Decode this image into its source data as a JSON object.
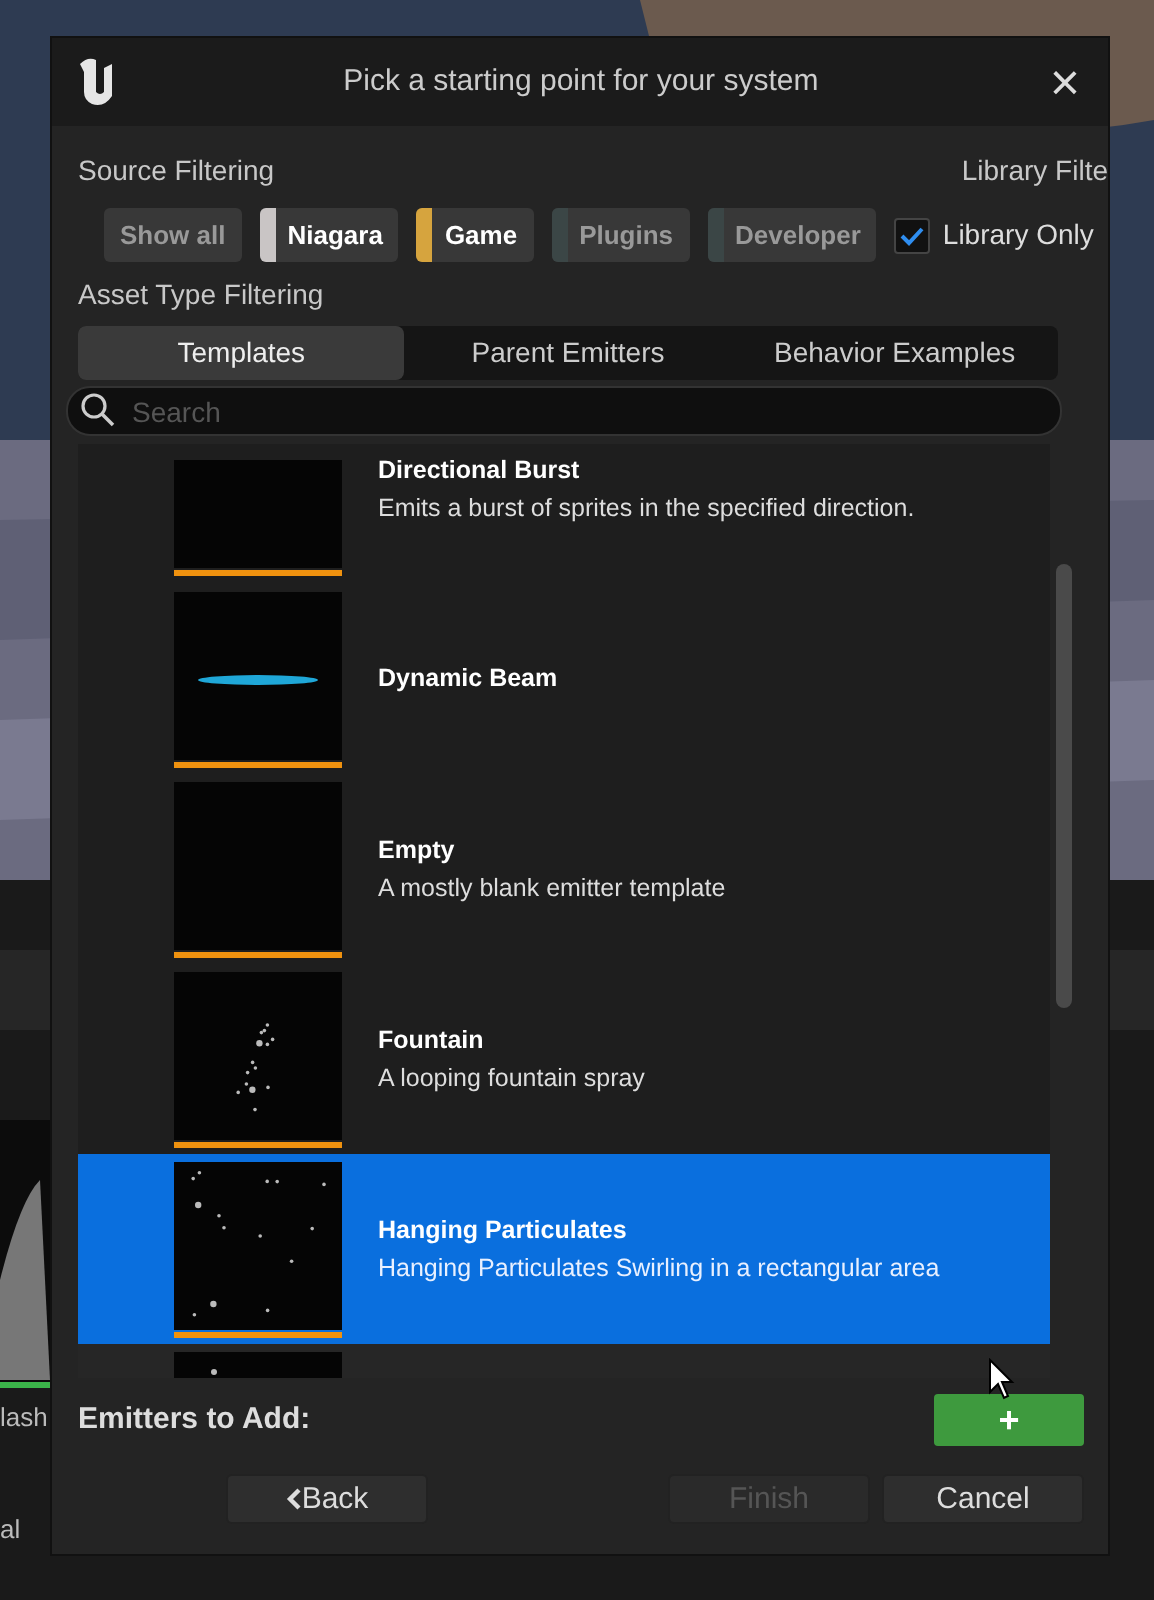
{
  "behind": {
    "texts": [
      "lash",
      "al"
    ]
  },
  "window": {
    "title": "Pick a starting point for your system",
    "close": "×"
  },
  "source_filtering": {
    "label": "Source Filtering",
    "chips": [
      {
        "label": "Show all",
        "kind": "all",
        "on": false
      },
      {
        "label": "Niagara",
        "kind": "source",
        "on": true,
        "color": "#c9c5c5"
      },
      {
        "label": "Game",
        "kind": "source",
        "on": true,
        "color": "#d6a43e"
      },
      {
        "label": "Plugins",
        "kind": "source",
        "on": false,
        "color": "#3b4646"
      },
      {
        "label": "Developer",
        "kind": "source",
        "on": false,
        "color": "#3b4646"
      }
    ]
  },
  "library_filter": {
    "label": "Library Filte",
    "checkbox": {
      "label": "Library Only",
      "checked": true
    }
  },
  "asset_type_filtering": {
    "label": "Asset Type Filtering",
    "tabs": [
      {
        "label": "Templates",
        "selected": true
      },
      {
        "label": "Parent Emitters",
        "selected": false
      },
      {
        "label": "Behavior Examples",
        "selected": false
      }
    ]
  },
  "search": {
    "placeholder": "Search"
  },
  "emitters": [
    {
      "title": "Directional Burst",
      "description": "Emits a burst of sprites in the specified direction.",
      "kind": "burst",
      "selected": false
    },
    {
      "title": "Dynamic Beam",
      "kind": "beam",
      "selected": false
    },
    {
      "title": "Empty",
      "description": "A mostly blank emitter template",
      "kind": "empty",
      "selected": false
    },
    {
      "title": "Fountain",
      "description": "A looping fountain spray",
      "kind": "fountain",
      "selected": false
    },
    {
      "title": "Hanging Particulates",
      "description": "Hanging Particulates Swirling in a rectangular area",
      "kind": "scatter",
      "selected": true
    }
  ],
  "emitters_to_add": {
    "label": "Emitters to Add:",
    "add": "+"
  },
  "buttons": [
    {
      "label": "Back",
      "kind": "back",
      "disabled": false
    },
    {
      "label": "Finish",
      "kind": "normal",
      "disabled": true
    },
    {
      "label": "Cancel",
      "kind": "normal",
      "disabled": false
    }
  ]
}
